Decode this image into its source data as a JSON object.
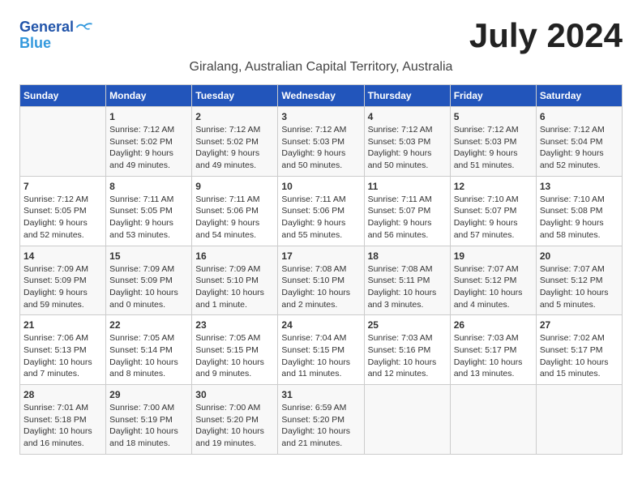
{
  "logo": {
    "line1": "General",
    "line2": "Blue"
  },
  "title": "July 2024",
  "subtitle": "Giralang, Australian Capital Territory, Australia",
  "days_of_week": [
    "Sunday",
    "Monday",
    "Tuesday",
    "Wednesday",
    "Thursday",
    "Friday",
    "Saturday"
  ],
  "weeks": [
    [
      {
        "day": "",
        "info": ""
      },
      {
        "day": "1",
        "info": "Sunrise: 7:12 AM\nSunset: 5:02 PM\nDaylight: 9 hours\nand 49 minutes."
      },
      {
        "day": "2",
        "info": "Sunrise: 7:12 AM\nSunset: 5:02 PM\nDaylight: 9 hours\nand 49 minutes."
      },
      {
        "day": "3",
        "info": "Sunrise: 7:12 AM\nSunset: 5:03 PM\nDaylight: 9 hours\nand 50 minutes."
      },
      {
        "day": "4",
        "info": "Sunrise: 7:12 AM\nSunset: 5:03 PM\nDaylight: 9 hours\nand 50 minutes."
      },
      {
        "day": "5",
        "info": "Sunrise: 7:12 AM\nSunset: 5:03 PM\nDaylight: 9 hours\nand 51 minutes."
      },
      {
        "day": "6",
        "info": "Sunrise: 7:12 AM\nSunset: 5:04 PM\nDaylight: 9 hours\nand 52 minutes."
      }
    ],
    [
      {
        "day": "7",
        "info": "Sunrise: 7:12 AM\nSunset: 5:05 PM\nDaylight: 9 hours\nand 52 minutes."
      },
      {
        "day": "8",
        "info": "Sunrise: 7:11 AM\nSunset: 5:05 PM\nDaylight: 9 hours\nand 53 minutes."
      },
      {
        "day": "9",
        "info": "Sunrise: 7:11 AM\nSunset: 5:06 PM\nDaylight: 9 hours\nand 54 minutes."
      },
      {
        "day": "10",
        "info": "Sunrise: 7:11 AM\nSunset: 5:06 PM\nDaylight: 9 hours\nand 55 minutes."
      },
      {
        "day": "11",
        "info": "Sunrise: 7:11 AM\nSunset: 5:07 PM\nDaylight: 9 hours\nand 56 minutes."
      },
      {
        "day": "12",
        "info": "Sunrise: 7:10 AM\nSunset: 5:07 PM\nDaylight: 9 hours\nand 57 minutes."
      },
      {
        "day": "13",
        "info": "Sunrise: 7:10 AM\nSunset: 5:08 PM\nDaylight: 9 hours\nand 58 minutes."
      }
    ],
    [
      {
        "day": "14",
        "info": "Sunrise: 7:09 AM\nSunset: 5:09 PM\nDaylight: 9 hours\nand 59 minutes."
      },
      {
        "day": "15",
        "info": "Sunrise: 7:09 AM\nSunset: 5:09 PM\nDaylight: 10 hours\nand 0 minutes."
      },
      {
        "day": "16",
        "info": "Sunrise: 7:09 AM\nSunset: 5:10 PM\nDaylight: 10 hours\nand 1 minute."
      },
      {
        "day": "17",
        "info": "Sunrise: 7:08 AM\nSunset: 5:10 PM\nDaylight: 10 hours\nand 2 minutes."
      },
      {
        "day": "18",
        "info": "Sunrise: 7:08 AM\nSunset: 5:11 PM\nDaylight: 10 hours\nand 3 minutes."
      },
      {
        "day": "19",
        "info": "Sunrise: 7:07 AM\nSunset: 5:12 PM\nDaylight: 10 hours\nand 4 minutes."
      },
      {
        "day": "20",
        "info": "Sunrise: 7:07 AM\nSunset: 5:12 PM\nDaylight: 10 hours\nand 5 minutes."
      }
    ],
    [
      {
        "day": "21",
        "info": "Sunrise: 7:06 AM\nSunset: 5:13 PM\nDaylight: 10 hours\nand 7 minutes."
      },
      {
        "day": "22",
        "info": "Sunrise: 7:05 AM\nSunset: 5:14 PM\nDaylight: 10 hours\nand 8 minutes."
      },
      {
        "day": "23",
        "info": "Sunrise: 7:05 AM\nSunset: 5:15 PM\nDaylight: 10 hours\nand 9 minutes."
      },
      {
        "day": "24",
        "info": "Sunrise: 7:04 AM\nSunset: 5:15 PM\nDaylight: 10 hours\nand 11 minutes."
      },
      {
        "day": "25",
        "info": "Sunrise: 7:03 AM\nSunset: 5:16 PM\nDaylight: 10 hours\nand 12 minutes."
      },
      {
        "day": "26",
        "info": "Sunrise: 7:03 AM\nSunset: 5:17 PM\nDaylight: 10 hours\nand 13 minutes."
      },
      {
        "day": "27",
        "info": "Sunrise: 7:02 AM\nSunset: 5:17 PM\nDaylight: 10 hours\nand 15 minutes."
      }
    ],
    [
      {
        "day": "28",
        "info": "Sunrise: 7:01 AM\nSunset: 5:18 PM\nDaylight: 10 hours\nand 16 minutes."
      },
      {
        "day": "29",
        "info": "Sunrise: 7:00 AM\nSunset: 5:19 PM\nDaylight: 10 hours\nand 18 minutes."
      },
      {
        "day": "30",
        "info": "Sunrise: 7:00 AM\nSunset: 5:20 PM\nDaylight: 10 hours\nand 19 minutes."
      },
      {
        "day": "31",
        "info": "Sunrise: 6:59 AM\nSunset: 5:20 PM\nDaylight: 10 hours\nand 21 minutes."
      },
      {
        "day": "",
        "info": ""
      },
      {
        "day": "",
        "info": ""
      },
      {
        "day": "",
        "info": ""
      }
    ]
  ]
}
